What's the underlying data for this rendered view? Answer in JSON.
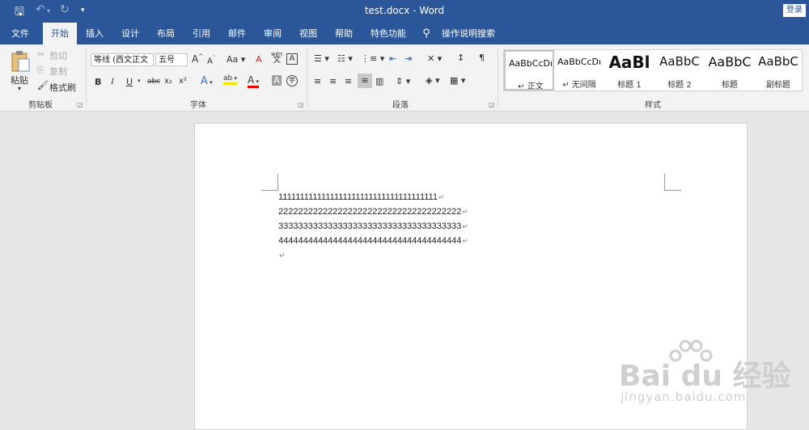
{
  "window": {
    "title": "test.docx  -  Word",
    "signin": "登录"
  },
  "quick_access": {
    "save_icon": "save-icon",
    "undo_icon": "undo-icon",
    "redo_icon": "redo-icon",
    "customize_icon": "customize-icon"
  },
  "tabs": [
    "文件",
    "开始",
    "插入",
    "设计",
    "布局",
    "引用",
    "邮件",
    "审阅",
    "视图",
    "帮助",
    "特色功能",
    "操作说明搜索"
  ],
  "active_tab": "开始",
  "clipboard": {
    "paste": "粘贴",
    "cut": "剪切",
    "copy": "复制",
    "format_painter": "格式刷",
    "group_label": "剪贴板"
  },
  "font": {
    "family": "等线 (西文正文",
    "size": "五号",
    "aa": "Aa",
    "group_label": "字体",
    "bold": "B",
    "italic": "I",
    "underline": "U",
    "strike": "abc",
    "sub": "x₂",
    "sup": "x²",
    "grow": "A",
    "shrink": "A",
    "clear": "A",
    "phonetic_top": "wén",
    "phonetic_bottom": "文",
    "border_char": "A",
    "text_effect": "A",
    "highlight": "ab",
    "font_color": "A",
    "shading": "A",
    "enclose": "字"
  },
  "paragraph": {
    "group_label": "段落"
  },
  "styles": {
    "group_label": "样式",
    "items": [
      {
        "preview": "AaBbCcDı",
        "name": "↵ 正文"
      },
      {
        "preview": "AaBbCcDı",
        "name": "↵ 无间隔"
      },
      {
        "preview": "AaBl",
        "name": "标题 1"
      },
      {
        "preview": "AaBbC",
        "name": "标题 2"
      },
      {
        "preview": "AaBbC",
        "name": "标题"
      },
      {
        "preview": "AaBbC",
        "name": "副标题"
      }
    ]
  },
  "document": {
    "lines": [
      "1111111111111111111111111111111111111",
      "2222222222222222222222222222222222222",
      "3333333333333333333333333333333333333",
      "4444444444444444444444444444444444444",
      ""
    ],
    "paragraph_mark": "↵"
  },
  "watermark": {
    "main": "Bai du 经验",
    "sub": "jingyan.baidu.com"
  }
}
